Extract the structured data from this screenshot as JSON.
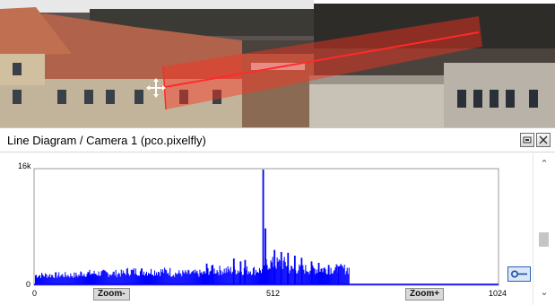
{
  "window": {
    "title": "Line Diagram / Camera 1 (pco.pixelfly)"
  },
  "buttons": {
    "restore_icon": "restore-icon",
    "close_icon": "close-icon"
  },
  "plot": {
    "zoom_minus_label": "Zoom-",
    "zoom_plus_label": "Zoom+",
    "y_tick_top": "16k",
    "y_tick_bottom": "0",
    "x_tick_0": "0",
    "x_tick_512": "512",
    "x_tick_1024": "1024",
    "line_color": "#0000ff",
    "key_icon": "key-icon"
  },
  "chart_data": {
    "type": "bar",
    "x_range": [
      0,
      1024
    ],
    "y_range": [
      0,
      16000
    ],
    "x_ticks": [
      "0",
      "512",
      "1024"
    ],
    "y_ticks": [
      "0",
      "16k"
    ],
    "grid": false,
    "color": "#0000ff",
    "segments": [
      {
        "x_start": 0,
        "x_end": 100,
        "level": 1500
      },
      {
        "x_start": 100,
        "x_end": 200,
        "level": 1800
      },
      {
        "x_start": 200,
        "x_end": 300,
        "level": 2100
      },
      {
        "x_start": 300,
        "x_end": 380,
        "level": 1800
      },
      {
        "x_start": 380,
        "x_end": 505,
        "level": 2300
      },
      {
        "x_start": 505,
        "x_end": 560,
        "level": 3400
      },
      {
        "x_start": 560,
        "x_end": 696,
        "level": 2500
      },
      {
        "x_start": 696,
        "x_end": 1024,
        "level": 0
      }
    ],
    "peaks": [
      {
        "x": 505,
        "y": 16000
      },
      {
        "x": 510,
        "y": 7800
      },
      {
        "x": 530,
        "y": 4800
      },
      {
        "x": 545,
        "y": 4500
      },
      {
        "x": 560,
        "y": 4400
      },
      {
        "x": 575,
        "y": 4000
      },
      {
        "x": 590,
        "y": 3700
      },
      {
        "x": 612,
        "y": 3200
      },
      {
        "x": 628,
        "y": 3000
      },
      {
        "x": 650,
        "y": 2700
      },
      {
        "x": 672,
        "y": 2500
      },
      {
        "x": 440,
        "y": 3600
      },
      {
        "x": 455,
        "y": 3200
      },
      {
        "x": 465,
        "y": 3400
      },
      {
        "x": 380,
        "y": 2900
      },
      {
        "x": 393,
        "y": 2700
      }
    ]
  }
}
